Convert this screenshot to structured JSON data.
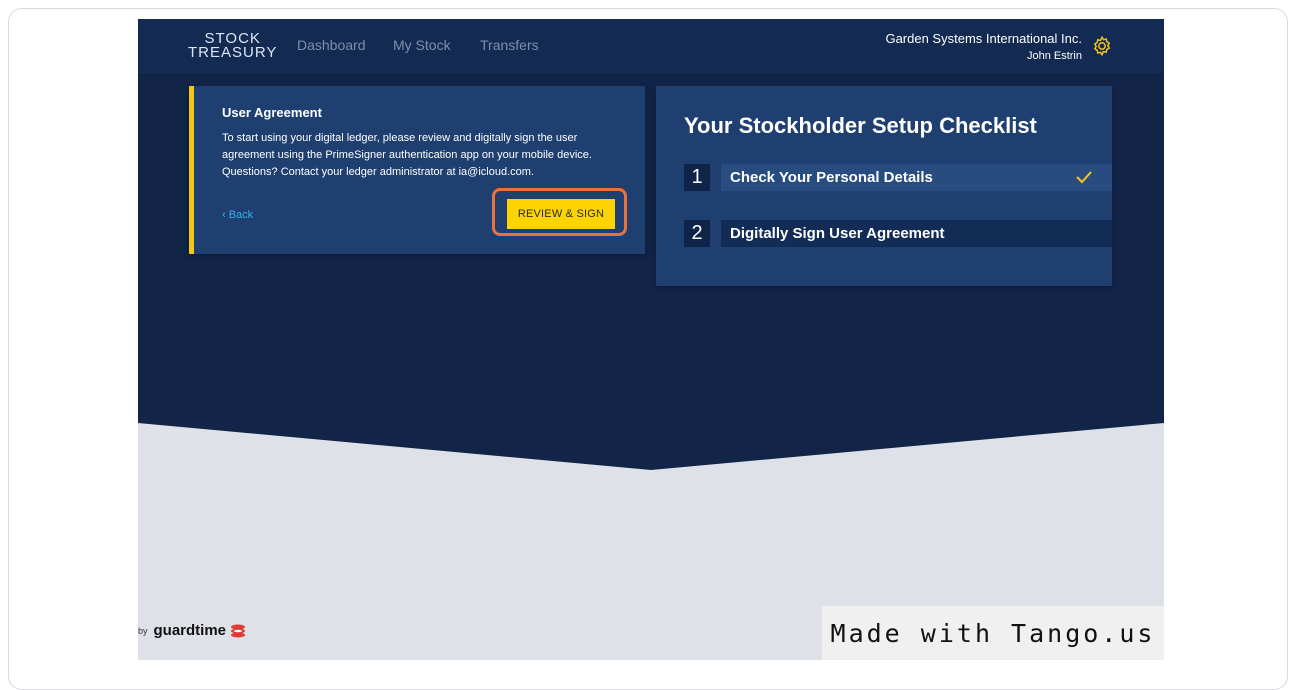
{
  "logo": {
    "line1": "STOCK",
    "line2": "TREASURY"
  },
  "nav": [
    "Dashboard",
    "My Stock",
    "Transfers"
  ],
  "org": {
    "company": "Garden Systems International Inc.",
    "user": "John Estrin"
  },
  "agreement": {
    "title": "User Agreement",
    "body": "To start using your digital ledger, please review and digitally sign the user agreement using the PrimeSigner authentication app on your mobile device. Questions? Contact your ledger administrator at        ia@icloud.com.",
    "back_label": "‹  Back",
    "button_label": "REVIEW & SIGN"
  },
  "checklist": {
    "heading": "Your Stockholder Setup Checklist",
    "steps": [
      {
        "number": "1",
        "label": "Check Your Personal Details",
        "done": true
      },
      {
        "number": "2",
        "label": "Digitally Sign User Agreement",
        "done": false
      }
    ]
  },
  "footer": {
    "by": "by",
    "brand": "guardtime"
  },
  "watermark": "Made with Tango.us",
  "colors": {
    "navy": "#122448",
    "card": "#1e3f70",
    "accent_yellow": "#fcd500",
    "highlight_orange": "#e9713e",
    "link_blue": "#35b2e8"
  }
}
